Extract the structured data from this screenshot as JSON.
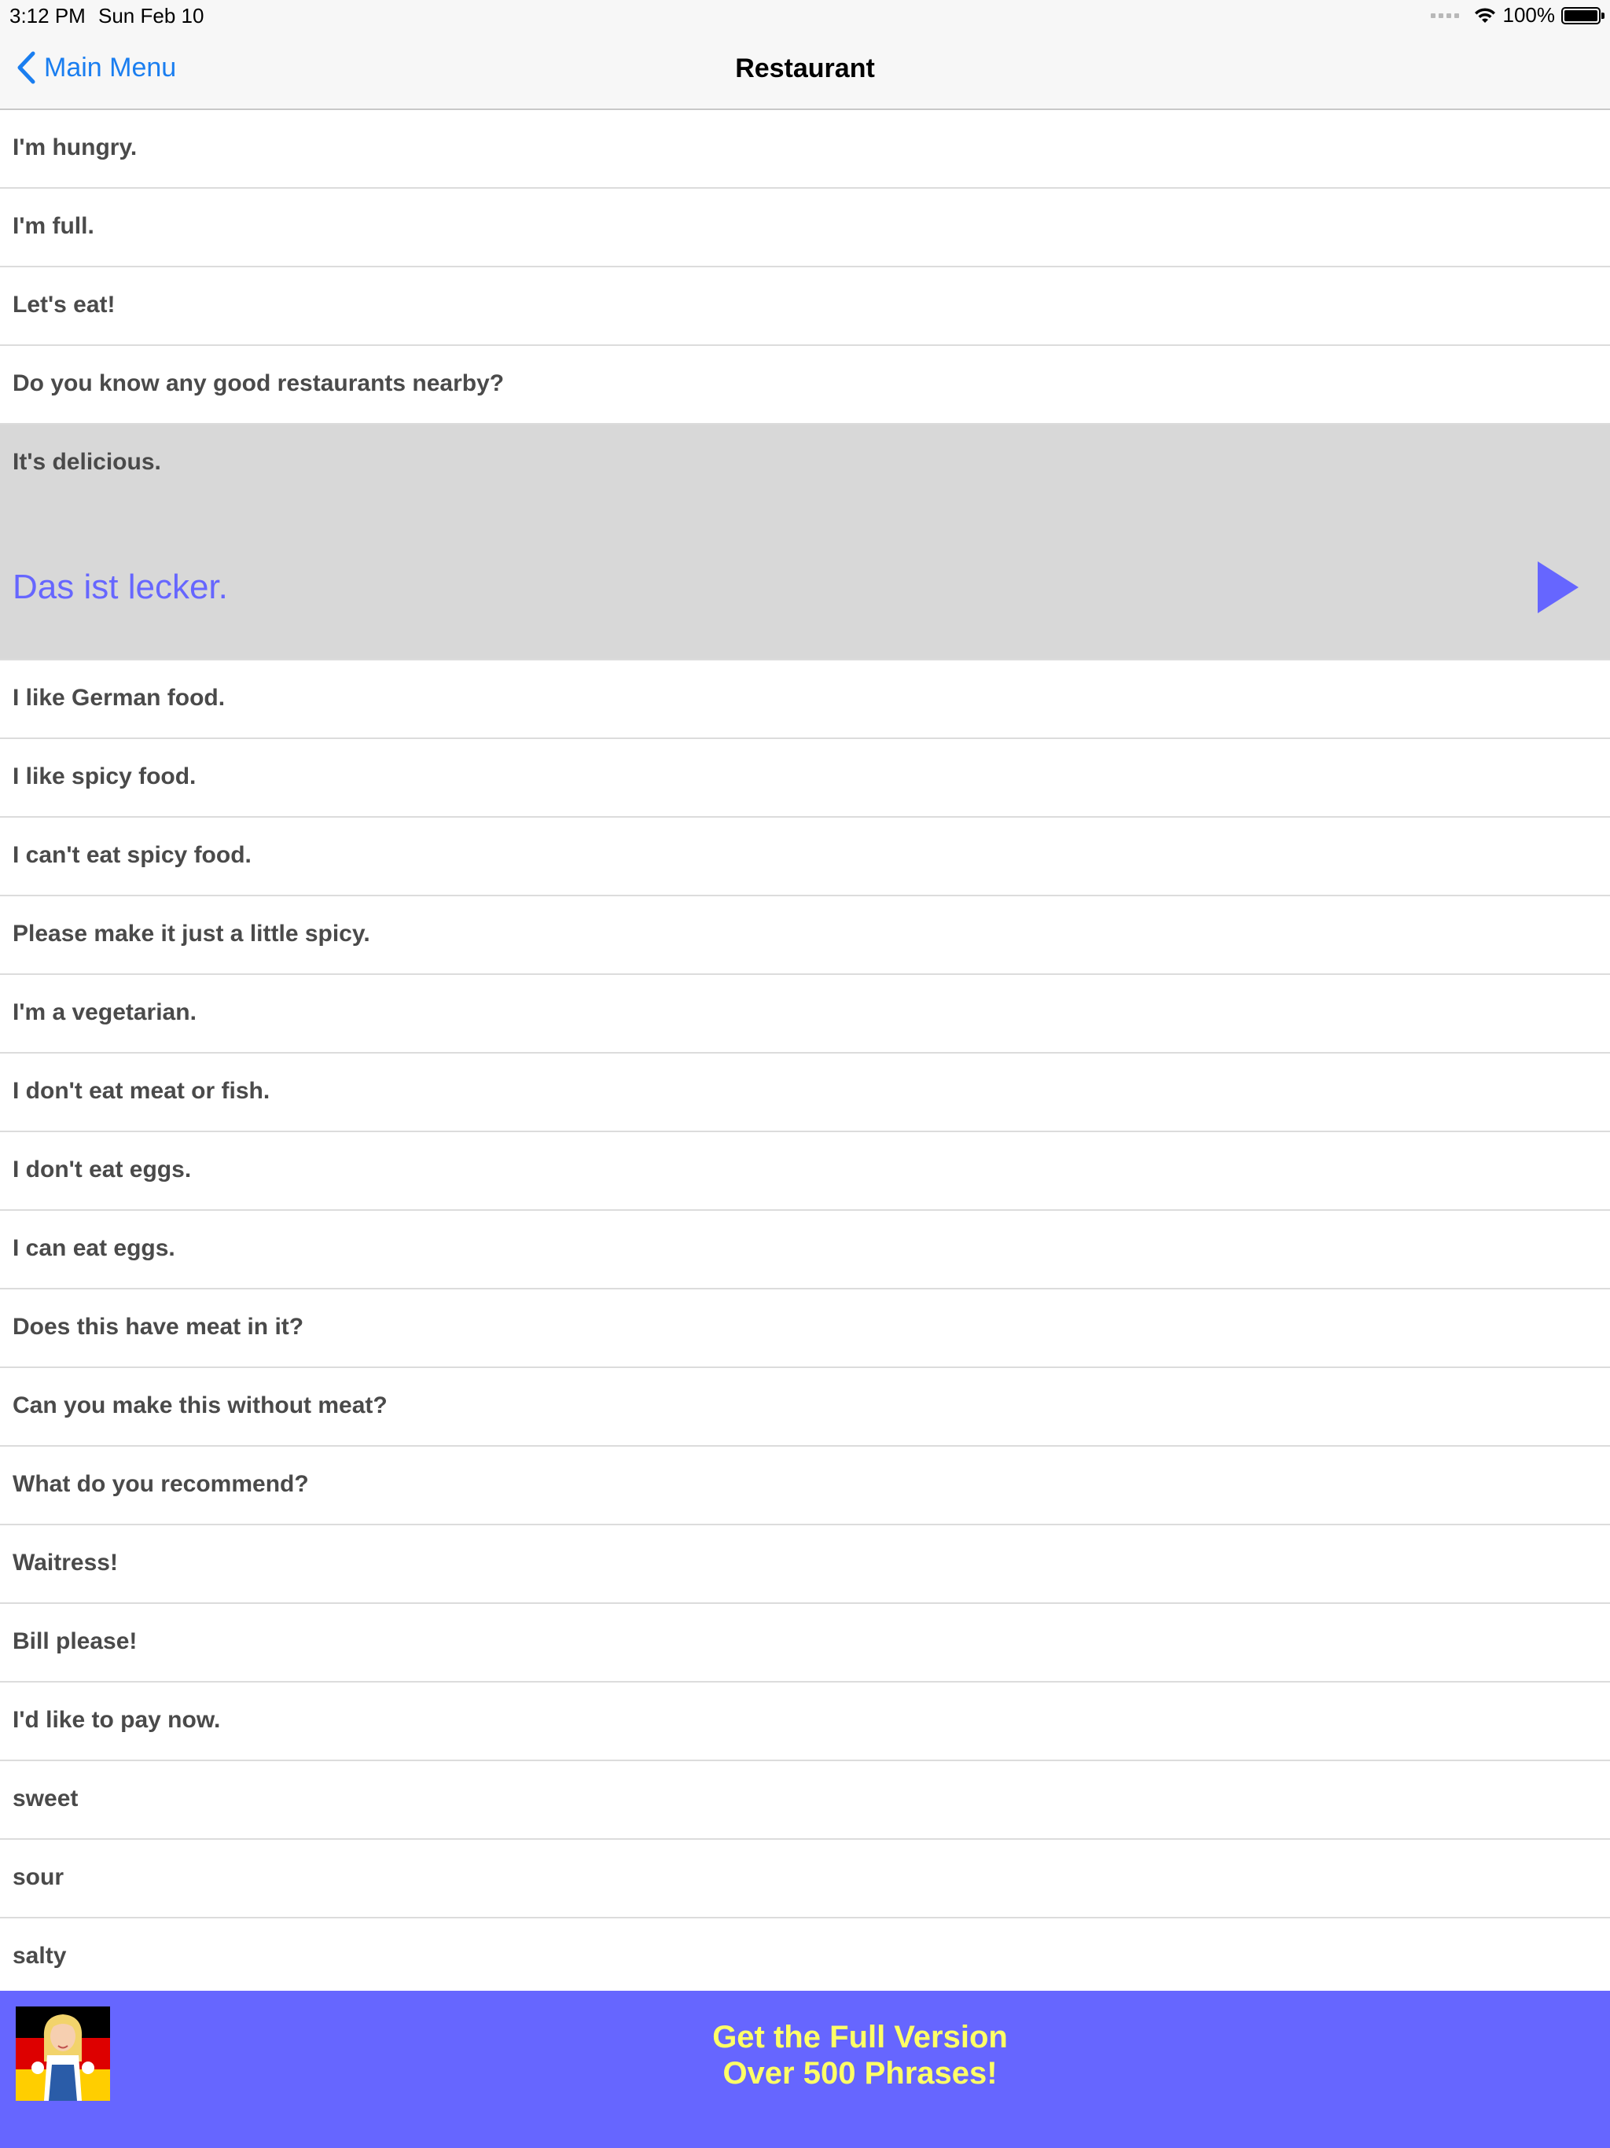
{
  "status_bar": {
    "time": "3:12 PM",
    "date": "Sun Feb 10",
    "battery": "100%"
  },
  "nav": {
    "back_label": "Main Menu",
    "title": "Restaurant"
  },
  "phrases": [
    {
      "en": "I'm hungry."
    },
    {
      "en": "I'm full."
    },
    {
      "en": "Let's eat!"
    },
    {
      "en": "Do you know any good restaurants nearby?"
    },
    {
      "en": "It's delicious.",
      "de": "Das ist lecker.",
      "expanded": true
    },
    {
      "en": "I like German food."
    },
    {
      "en": "I like spicy food."
    },
    {
      "en": "I can't eat spicy food."
    },
    {
      "en": "Please make it just a little spicy."
    },
    {
      "en": "I'm a vegetarian."
    },
    {
      "en": "I don't eat meat or fish."
    },
    {
      "en": "I don't eat eggs."
    },
    {
      "en": "I can eat eggs."
    },
    {
      "en": "Does this have meat in it?"
    },
    {
      "en": "Can you make this without meat?"
    },
    {
      "en": "What do you recommend?"
    },
    {
      "en": "Waitress!"
    },
    {
      "en": "Bill please!"
    },
    {
      "en": "I'd like to pay now."
    },
    {
      "en": "sweet"
    },
    {
      "en": "sour"
    },
    {
      "en": "salty"
    }
  ],
  "banner": {
    "line1": "Get the Full Version",
    "line2": "Over 500 Phrases!"
  },
  "colors": {
    "accent": "#1a7ef0",
    "translation": "#6666ff",
    "banner_bg": "#6666ff",
    "banner_text": "#ffff66",
    "expanded_row_bg": "#d8d8d8"
  },
  "icons": {
    "back": "chevron-left-icon",
    "play": "play-icon",
    "wifi": "wifi-icon",
    "battery": "battery-icon",
    "logo": "app-logo"
  }
}
